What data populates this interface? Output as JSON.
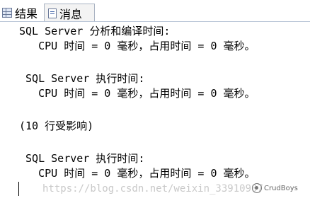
{
  "tabs": [
    {
      "label": "结果",
      "icon": "grid-icon"
    },
    {
      "label": "消息",
      "icon": "message-icon",
      "active": true
    }
  ],
  "messages": [
    "SQL Server 分析和编译时间:",
    "   CPU 时间 = 0 毫秒，占用时间 = 0 毫秒。",
    " SQL Server 执行时间:",
    "   CPU 时间 = 0 毫秒，占用时间 = 0 毫秒。",
    "(10 行受影响)",
    " SQL Server 执行时间:",
    "   CPU 时间 = 0 毫秒，占用时间 = 0 毫秒。"
  ],
  "watermark": {
    "url": "https://blog.csdn.net/weixin_33910907",
    "brand": "CrudBoys"
  }
}
